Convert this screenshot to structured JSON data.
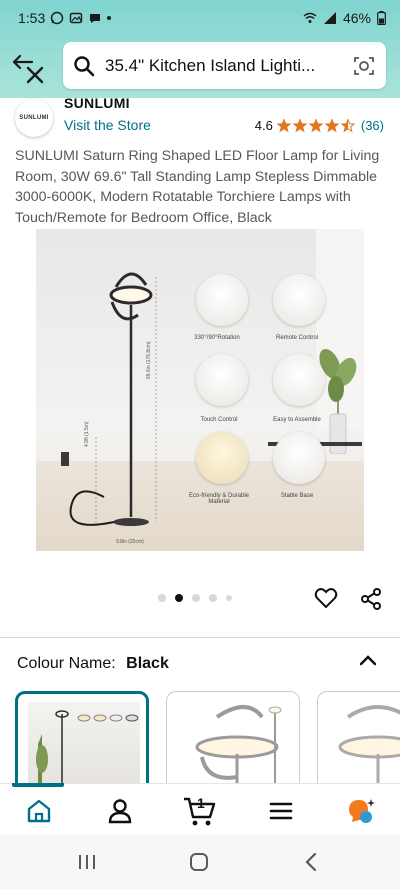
{
  "status_bar": {
    "time": "1:53",
    "battery": "46%"
  },
  "search": {
    "query": "35.4\" Kitchen Island Lighti..."
  },
  "store": {
    "brand": "SUNLUMI",
    "logo_text": "SUNLUMI",
    "visit_label": "Visit the Store",
    "rating_value": "4.6",
    "rating_stars": 4.5,
    "rating_count": "(36)"
  },
  "product": {
    "title": "SUNLUMI Saturn Ring Shaped LED Floor Lamp for Living Room, 30W 69.6\" Tall Standing Lamp Stepless Dimmable 3000-6000K, Modern Rotatable Torchiere Lamps with Touch/Remote for Bedroom Office, Black",
    "image_features": [
      "330°/90°Rotation",
      "Remote Control",
      "Touch Control",
      "Easy to Assemble",
      "Eco-friendly & Durable Material",
      "Stable Base"
    ],
    "image_dims": {
      "height": "69.6in (176.8cm)",
      "base": "4.9ft (1.5m)",
      "diameter": "9.8in (25cm)"
    },
    "carousel": {
      "count": 5,
      "active_index": 1
    }
  },
  "colour": {
    "label": "Colour Name:",
    "value": "Black"
  },
  "bottom_nav": {
    "cart_count": "1"
  },
  "colors": {
    "accent": "#007185",
    "star": "#de7921",
    "header_gradient_top": "#7fd3cf",
    "header_gradient_bottom": "#a9e3d8"
  }
}
